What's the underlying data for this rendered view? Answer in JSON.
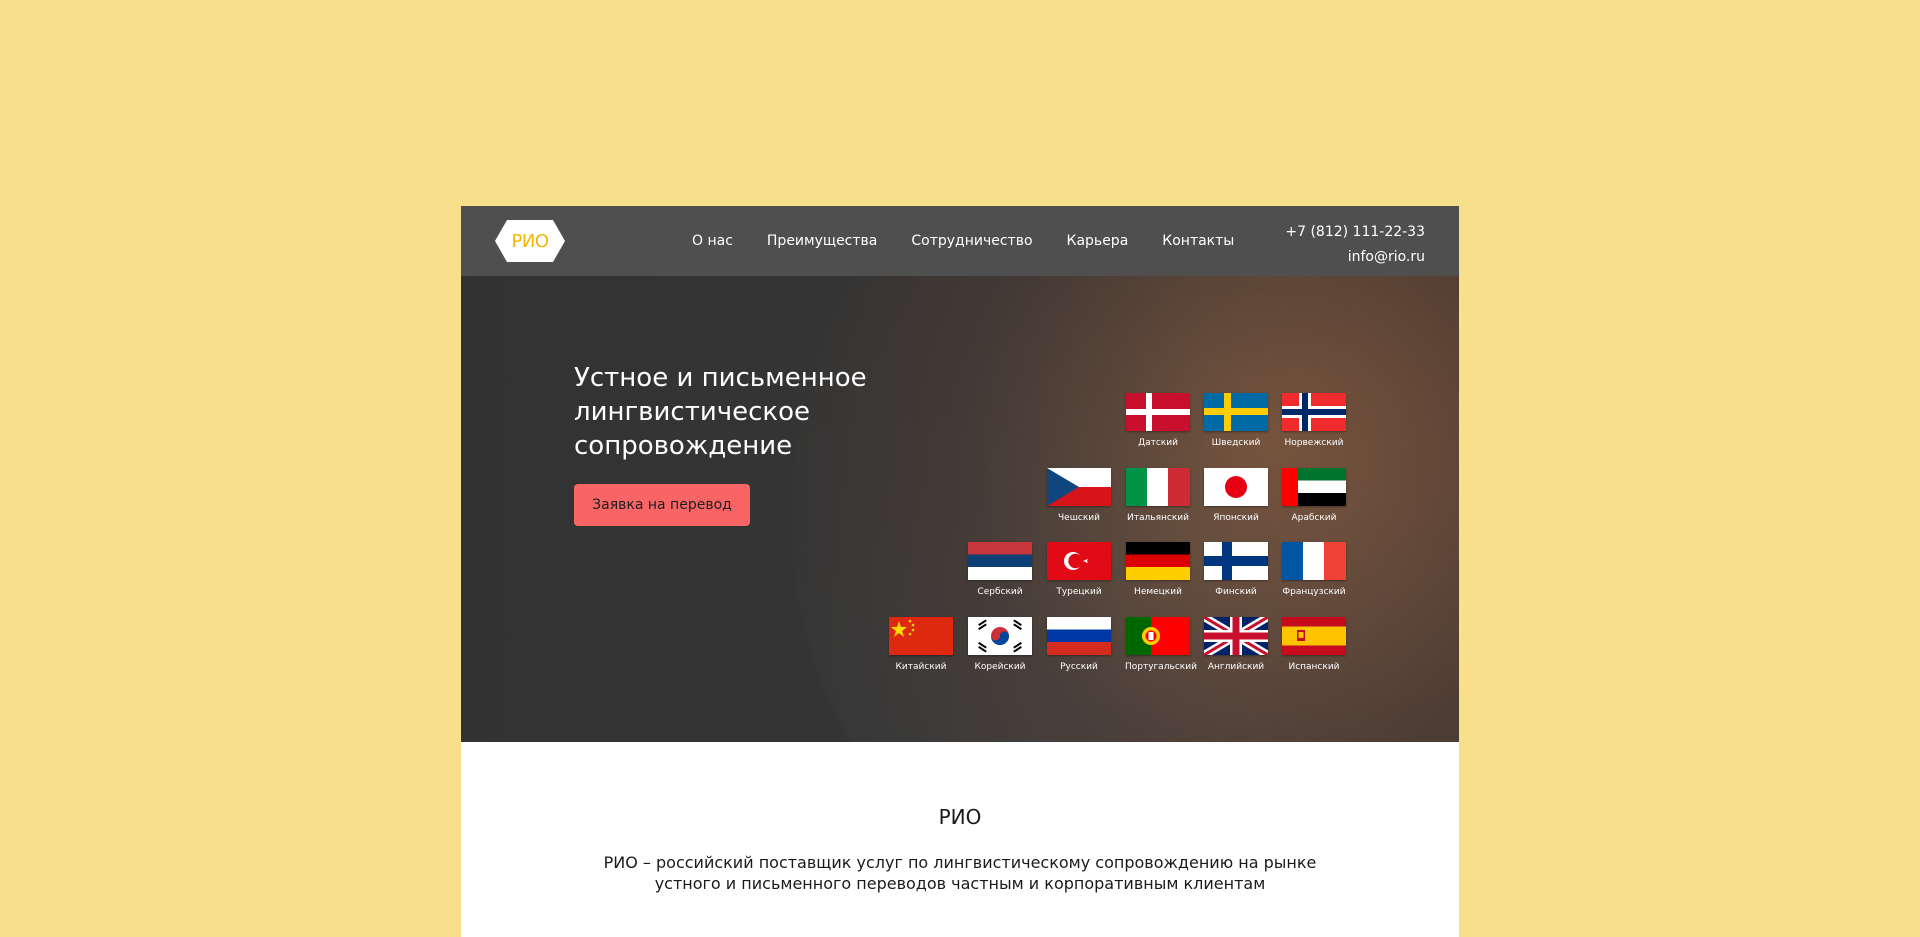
{
  "colors": {
    "page_bg": "#f7df8c",
    "header_bg": "#4f4f4f",
    "logo_accent": "#f2b705",
    "cta_bg": "#f86564"
  },
  "header": {
    "logo_text": "РИО",
    "nav": [
      "О нас",
      "Преимущества",
      "Сотрудничество",
      "Карьера",
      "Контакты"
    ],
    "phone": "+7 (812) 111-22-33",
    "email": "info@rio.ru"
  },
  "hero": {
    "title": "Устное и письменное лингвистическое сопровождение",
    "cta_label": "Заявка на перевод",
    "languages": [
      [
        "Датский",
        "Шведский",
        "Норвежский"
      ],
      [
        "Чешский",
        "Итальянский",
        "Японский",
        "Арабский"
      ],
      [
        "Сербский",
        "Турецкий",
        "Немецкий",
        "Финский",
        "Французский"
      ],
      [
        "Китайский",
        "Корейский",
        "Русский",
        "Португальский",
        "Английский",
        "Испанский"
      ]
    ]
  },
  "about": {
    "title": "РИО",
    "text": "РИО – российский поставщик услуг по лингвистическому сопровождению на рынке устного и письменного переводов частным и корпоративным клиентам"
  }
}
